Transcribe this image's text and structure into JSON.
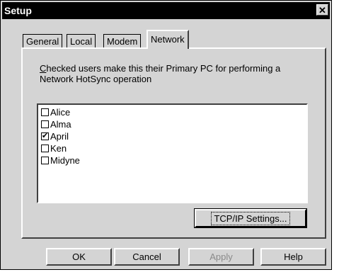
{
  "window": {
    "title": "Setup",
    "close_symbol": "✕"
  },
  "tabs": [
    {
      "label": "General",
      "active": false
    },
    {
      "label": "Local",
      "active": false
    },
    {
      "label": "Modem",
      "active": false
    },
    {
      "label": "Network",
      "active": true
    }
  ],
  "network_panel": {
    "description_access_key": "C",
    "description_line1_rest": "hecked users make this their Primary PC for performing a",
    "description_line2": "Network HotSync operation",
    "users": [
      {
        "name": "Alice",
        "checked": false
      },
      {
        "name": "Alma",
        "checked": false
      },
      {
        "name": "April",
        "checked": true
      },
      {
        "name": "Ken",
        "checked": false
      },
      {
        "name": "Midyne",
        "checked": false
      }
    ],
    "check_mark": "✔",
    "tcpip_button_label": "TCP/IP Settings..."
  },
  "buttons": {
    "ok": "OK",
    "cancel": "Cancel",
    "apply": "Apply",
    "help": "Help"
  }
}
